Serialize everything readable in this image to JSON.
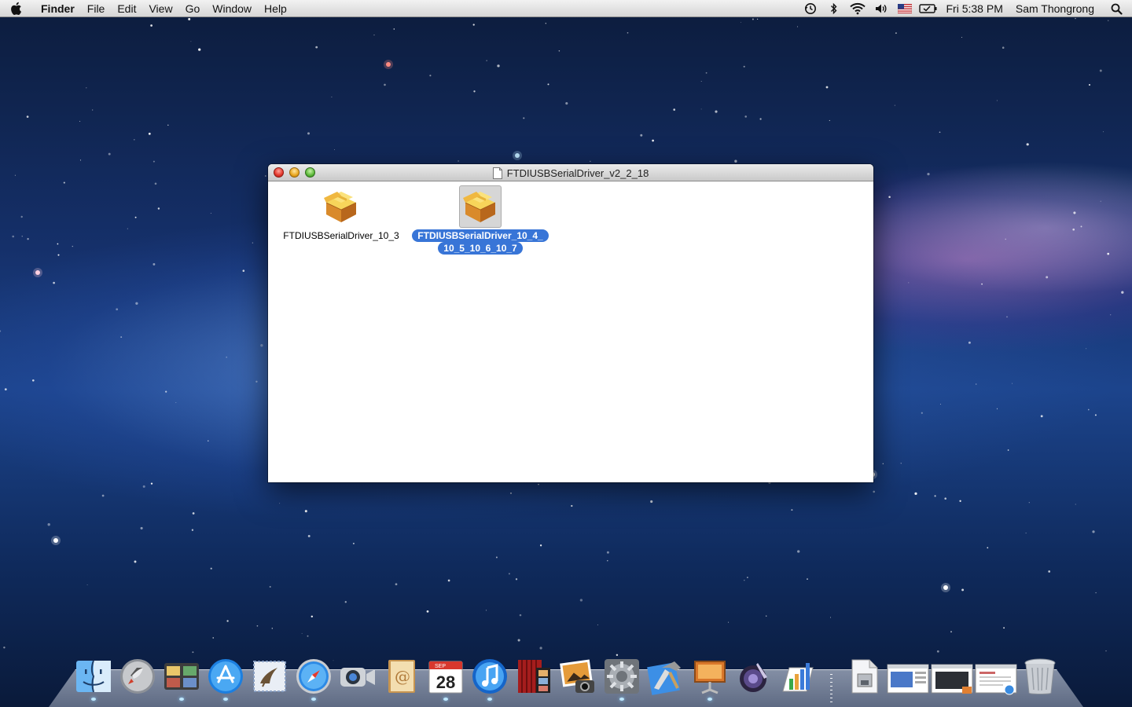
{
  "menubar": {
    "app_name": "Finder",
    "menus": [
      "File",
      "Edit",
      "View",
      "Go",
      "Window",
      "Help"
    ],
    "status_icons": [
      "time-machine-icon",
      "bluetooth-icon",
      "wifi-icon",
      "volume-icon",
      "us-flag-input-icon",
      "battery-icon"
    ],
    "clock": "Fri 5:38 PM",
    "user": "Sam Thongrong"
  },
  "window": {
    "title": "FTDIUSBSerialDriver_v2_2_18",
    "files": [
      {
        "name": "FTDIUSBSerialDriver_10_3",
        "selected": false,
        "icon": "package-icon"
      },
      {
        "name": "FTDIUSBSerialDriver_10_4_10_5_10_6_10_7",
        "label_line1": "FTDIUSBSerialDriver_10_4_",
        "label_line2": "10_5_10_6_10_7",
        "selected": true,
        "icon": "package-icon"
      }
    ]
  },
  "dock": {
    "apps": [
      "finder-icon",
      "launchpad-icon",
      "photo-booth-icon",
      "app-store-icon",
      "mail-icon",
      "safari-icon",
      "facetime-icon",
      "address-book-icon",
      "calendar-icon",
      "itunes-icon",
      "photo-booth-curtain-icon",
      "iphoto-icon",
      "system-preferences-icon",
      "xcode-icon",
      "keynote-icon",
      "aperture-icon",
      "numbers-icon"
    ],
    "calendar_month": "SEP",
    "calendar_day": "28",
    "stacks": [
      "installer-icon",
      "preview-window-icon",
      "display-window-icon",
      "safari-window-icon",
      "trash-icon"
    ]
  }
}
